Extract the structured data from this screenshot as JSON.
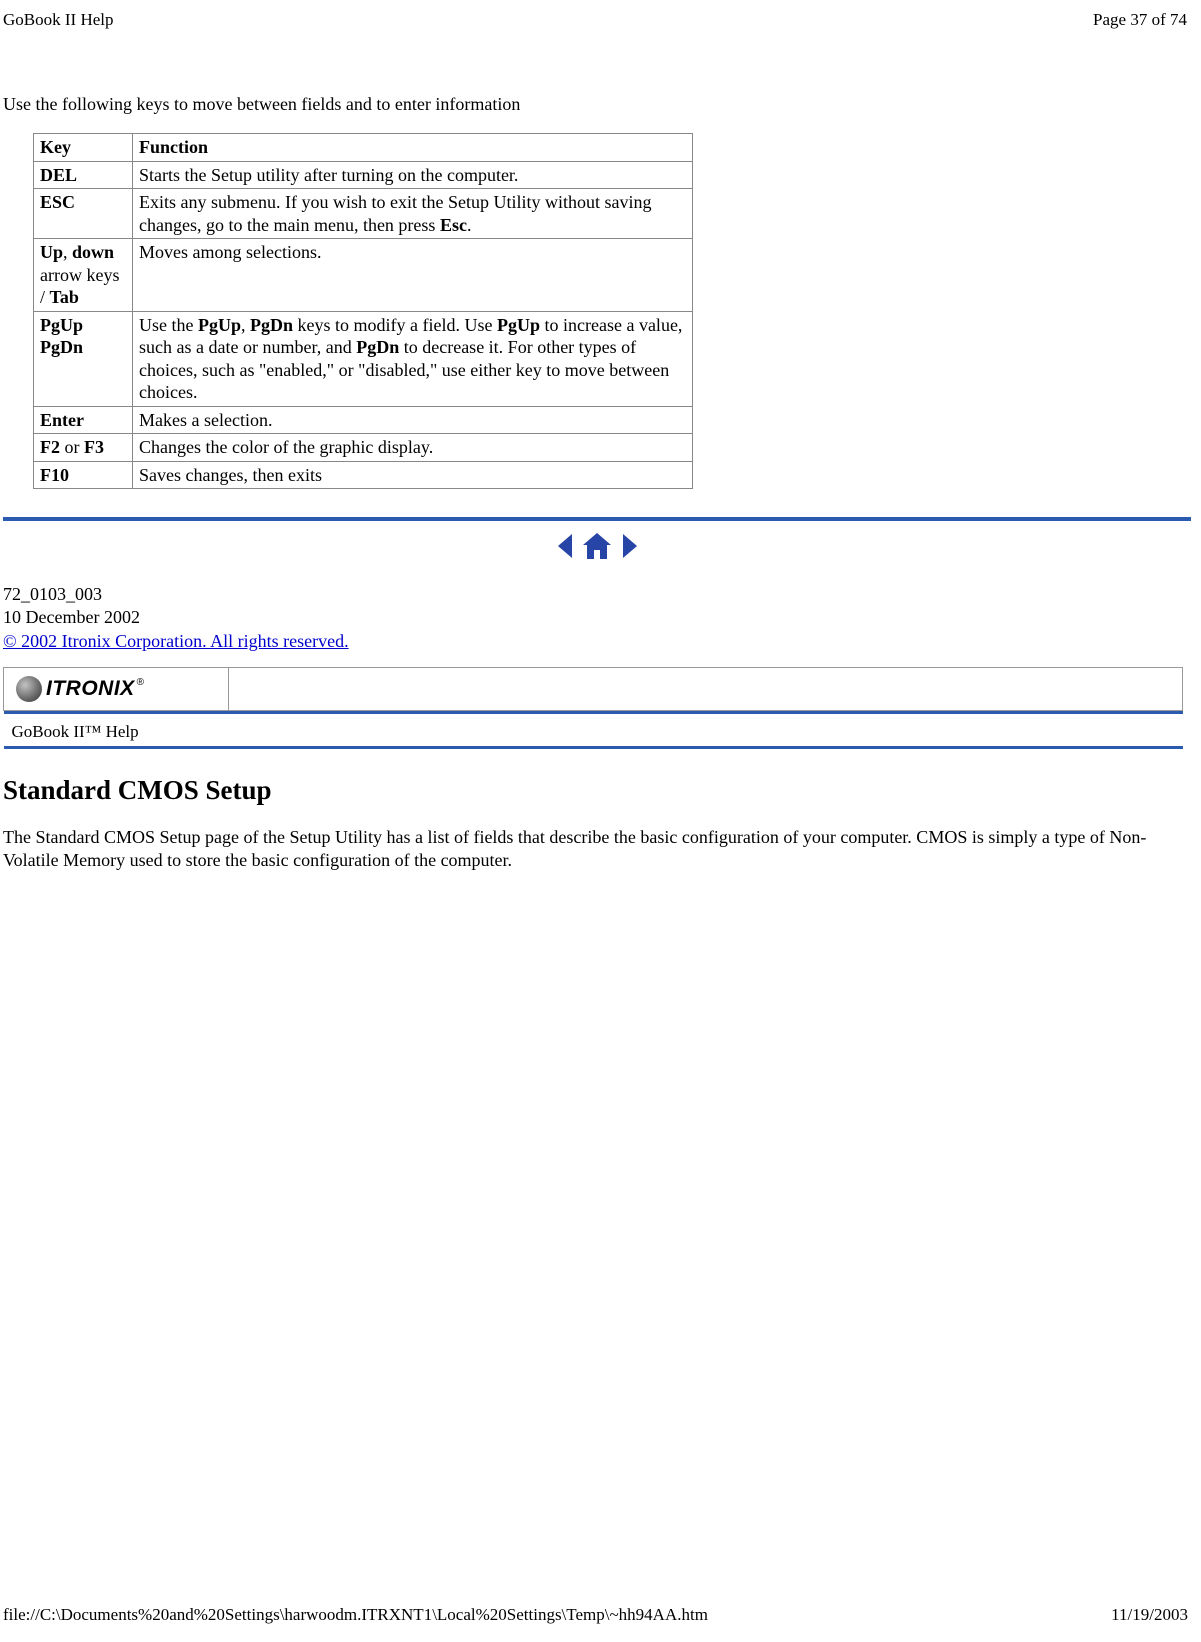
{
  "header": {
    "title": "GoBook II Help",
    "page_info": "Page 37 of 74"
  },
  "intro_text": "Use the following keys to move between fields and to enter information",
  "table": {
    "headers": {
      "key": "Key",
      "function": "Function"
    },
    "rows": [
      {
        "key_parts": [
          {
            "text": "DEL",
            "bold": true
          }
        ],
        "function_parts": [
          {
            "text": "Starts the Setup utility after turning on the computer."
          }
        ]
      },
      {
        "key_parts": [
          {
            "text": "ESC",
            "bold": true
          }
        ],
        "function_parts": [
          {
            "text": "Exits any submenu.  If you wish to exit the Setup Utility without saving changes, go to the main menu, then press "
          },
          {
            "text": "Esc",
            "bold": true
          },
          {
            "text": "."
          }
        ]
      },
      {
        "key_parts": [
          {
            "text": "Up",
            "bold": true
          },
          {
            "text": ", "
          },
          {
            "text": "down",
            "bold": true
          },
          {
            "text": " arrow keys / "
          },
          {
            "text": "Tab",
            "bold": true
          }
        ],
        "function_parts": [
          {
            "text": "Moves among selections."
          }
        ]
      },
      {
        "key_parts": [
          {
            "text": "PgUp",
            "bold": true
          },
          {
            "text": " "
          },
          {
            "text": "PgDn",
            "bold": true
          }
        ],
        "function_parts": [
          {
            "text": "Use the "
          },
          {
            "text": "PgUp",
            "bold": true
          },
          {
            "text": ", "
          },
          {
            "text": "PgDn",
            "bold": true
          },
          {
            "text": " keys to modify a field.  Use "
          },
          {
            "text": "PgUp",
            "bold": true
          },
          {
            "text": " to increase a value, such as a date or number, and "
          },
          {
            "text": "PgDn",
            "bold": true
          },
          {
            "text": " to decrease it.  For other types of choices, such as \"enabled,\" or \"disabled,\" use either key to move between choices."
          }
        ]
      },
      {
        "key_parts": [
          {
            "text": "Enter",
            "bold": true
          }
        ],
        "function_parts": [
          {
            "text": "Makes a selection."
          }
        ]
      },
      {
        "key_parts": [
          {
            "text": "F2",
            "bold": true
          },
          {
            "text": " or "
          },
          {
            "text": "F3",
            "bold": true
          }
        ],
        "function_parts": [
          {
            "text": "Changes the color of the graphic display."
          }
        ]
      },
      {
        "key_parts": [
          {
            "text": "F10",
            "bold": true
          }
        ],
        "function_parts": [
          {
            "text": "Saves changes, then exits"
          }
        ]
      }
    ]
  },
  "meta": {
    "doc_number": "72_0103_003",
    "date": "10 December 2002",
    "copyright": "© 2002 Itronix Corporation.  All rights reserved."
  },
  "logo": {
    "brand": "ITRONIX",
    "reg": "®",
    "subtitle": "GoBook II™ Help"
  },
  "section": {
    "heading": "Standard CMOS Setup",
    "paragraph": "The Standard CMOS Setup page of the Setup Utility has a list of fields that describe the basic configuration of your computer.  CMOS is simply a type of Non-Volatile Memory used to store the basic configuration of the computer."
  },
  "footer": {
    "path": "file://C:\\Documents%20and%20Settings\\harwoodm.ITRXNT1\\Local%20Settings\\Temp\\~hh94AA.htm",
    "date": "11/19/2003"
  }
}
